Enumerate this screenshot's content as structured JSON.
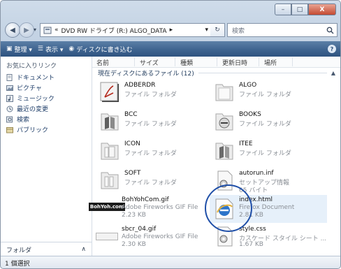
{
  "window": {
    "caption": {
      "minimize": "–",
      "maximize": "□",
      "close": "X"
    }
  },
  "nav": {
    "back_glyph": "◀",
    "forward_glyph": "▶",
    "dropdown_glyph": "▾",
    "breadcrumb": [
      "«",
      "DVD RW ドライブ (R:) ALGO_DATA",
      "▸"
    ],
    "address_dropdown": "▾",
    "refresh_glyph": "↻",
    "search_placeholder": "検索"
  },
  "toolbar": {
    "items": [
      {
        "icon": "▣",
        "label": "整理 ▾"
      },
      {
        "icon": "☰",
        "label": "表示 ▾"
      },
      {
        "icon": "◉",
        "label": "ディスクに書き込む"
      }
    ],
    "help": "?"
  },
  "navpane": {
    "heading": "お気に入りリンク",
    "items": [
      {
        "label": "ドキュメント",
        "icon": "document-icon"
      },
      {
        "label": "ピクチャ",
        "icon": "pictures-icon"
      },
      {
        "label": "ミュージック",
        "icon": "music-icon"
      },
      {
        "label": "最近の変更",
        "icon": "recent-icon"
      },
      {
        "label": "検索",
        "icon": "search-icon"
      },
      {
        "label": "パブリック",
        "icon": "public-icon"
      }
    ],
    "folders_label": "フォルダ",
    "folders_chevron": "∧"
  },
  "columns": [
    "名前",
    "サイズ",
    "種類",
    "更新日時",
    "場所"
  ],
  "group_header": "現在ディスクにあるファイル (12)",
  "files": [
    {
      "name": "ADBERDR",
      "type": "ファイル フォルダ",
      "size": "",
      "icon": "pdf-folder-icon"
    },
    {
      "name": "ALGO",
      "type": "ファイル フォルダ",
      "size": "",
      "icon": "folder-icon"
    },
    {
      "name": "BCC",
      "type": "ファイル フォルダ",
      "size": "",
      "icon": "folder-icon"
    },
    {
      "name": "BOOKS",
      "type": "ファイル フォルダ",
      "size": "",
      "icon": "folder-icon"
    },
    {
      "name": "ICON",
      "type": "ファイル フォルダ",
      "size": "",
      "icon": "folder-icon"
    },
    {
      "name": "ITEE",
      "type": "ファイル フォルダ",
      "size": "",
      "icon": "folder-icon"
    },
    {
      "name": "SOFT",
      "type": "ファイル フォルダ",
      "size": "",
      "icon": "folder-icon"
    },
    {
      "name": "autorun.inf",
      "type": "セットアップ情報",
      "size": "65 バイト",
      "icon": "settings-file-icon"
    },
    {
      "name": "BohYohCom.gif",
      "type": "Adobe Fireworks GIF File",
      "size": "2.23 KB",
      "icon": "gif-thumbnail-icon",
      "thumb_text": "BohYoh.com"
    },
    {
      "name": "index.html",
      "type": "Firefox Document",
      "size": "2.81 KB",
      "icon": "html-document-icon"
    },
    {
      "name": "sbcr_04.gif",
      "type": "Adobe Fireworks GIF File",
      "size": "2.30 KB",
      "icon": "gif-thumbnail-icon",
      "thumb_text": ""
    },
    {
      "name": "style.css",
      "type": "カスケード スタイル シート ...",
      "size": "1.67 KB",
      "icon": "css-file-icon"
    }
  ],
  "status": "1 個選択"
}
